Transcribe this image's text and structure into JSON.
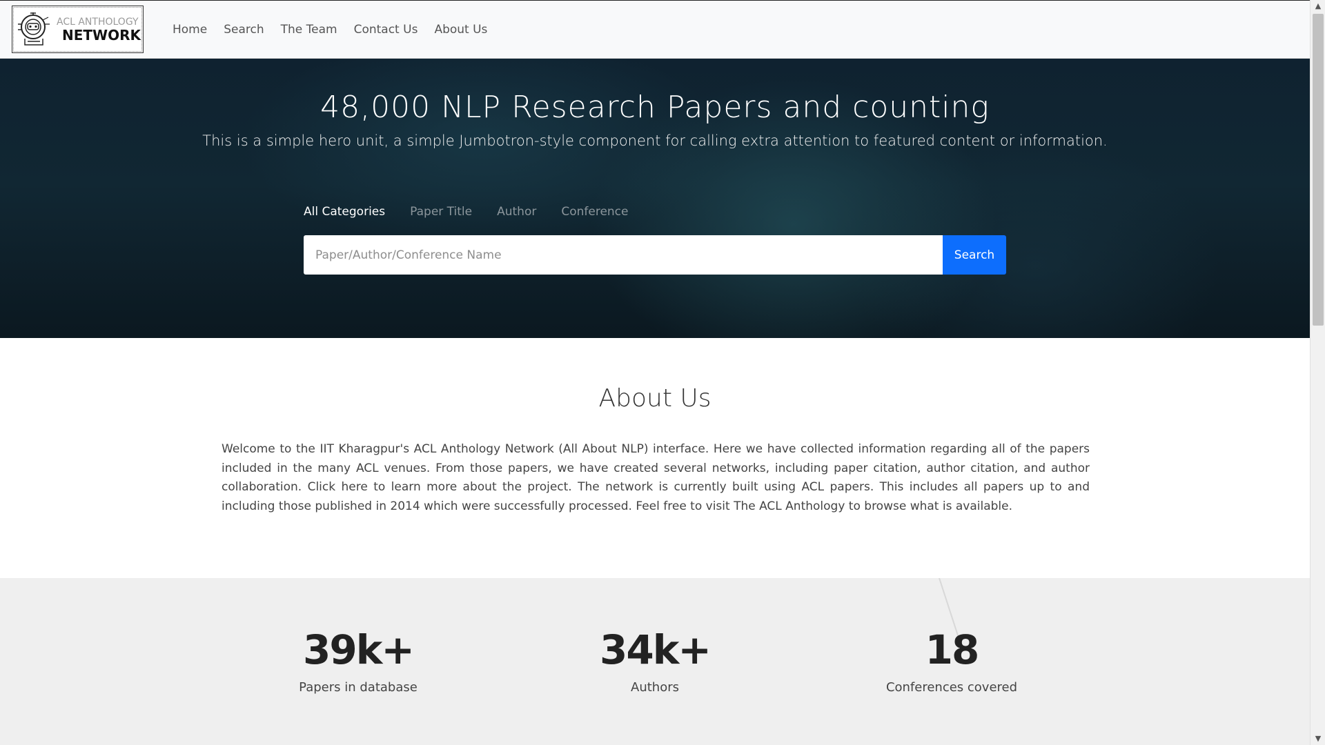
{
  "brand": {
    "top_text": "ACL ANTHOLOGY",
    "bottom_text": "NETWORK",
    "logo_icon": "robot-head-icon"
  },
  "nav": {
    "items": [
      {
        "label": "Home"
      },
      {
        "label": "Search"
      },
      {
        "label": "The Team"
      },
      {
        "label": "Contact Us"
      },
      {
        "label": "About Us"
      }
    ]
  },
  "hero": {
    "title": "48,000 NLP Research Papers and counting",
    "subtitle": "This is a simple hero unit, a simple Jumbotron-style component for calling extra attention to featured content or information.",
    "tabs": [
      {
        "label": "All Categories",
        "active": true
      },
      {
        "label": "Paper Title",
        "active": false
      },
      {
        "label": "Author",
        "active": false
      },
      {
        "label": "Conference",
        "active": false
      }
    ],
    "search": {
      "placeholder": "Paper/Author/Conference Name",
      "value": "",
      "button_label": "Search"
    }
  },
  "about": {
    "title": "About Us",
    "body": "Welcome to the IIT Kharagpur's ACL Anthology Network (All About NLP) interface. Here we have collected information regarding all of the papers included in the many ACL venues. From those papers, we have created several networks, including paper citation, author citation, and author collaboration. Click here to learn more about the project. The network is currently built using ACL papers. This includes all papers up to and including those published in 2014 which were successfully processed. Feel free to visit The ACL Anthology to browse what is available."
  },
  "stats": [
    {
      "value": "39k+",
      "label": "Papers in database"
    },
    {
      "value": "34k+",
      "label": "Authors"
    },
    {
      "value": "18",
      "label": "Conferences covered"
    }
  ],
  "colors": {
    "accent": "#0d6efd",
    "hero_bg": "#112733",
    "stats_bg": "#efefef"
  }
}
